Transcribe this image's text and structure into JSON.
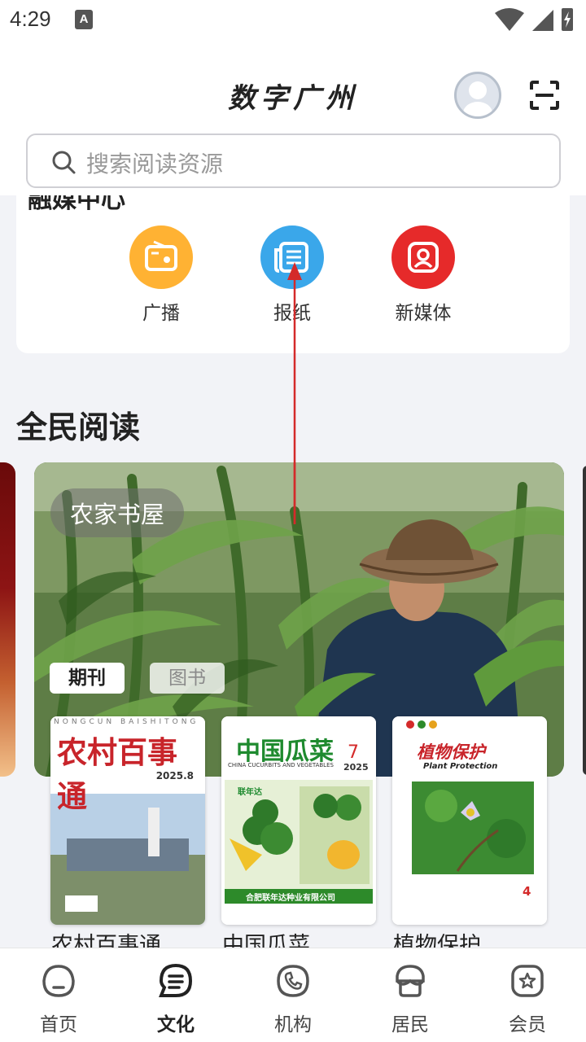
{
  "status": {
    "time": "4:29",
    "notification_letter": "A"
  },
  "header": {
    "title": "数字广州",
    "search_placeholder": "搜索阅读资源"
  },
  "media": {
    "title": "融媒中心",
    "items": [
      {
        "label": "广播",
        "color": "#ffb233"
      },
      {
        "label": "报纸",
        "color": "#3aa7ea"
      },
      {
        "label": "新媒体",
        "color": "#e62a2a"
      }
    ]
  },
  "reading": {
    "section_title": "全民阅读",
    "banner_label": "农家书屋",
    "tabs": [
      "期刊",
      "图书"
    ],
    "books": [
      {
        "title": "农村百事通",
        "cover_title": "农村百事通",
        "cover_subtitle": "NONGCUN BAISHITONG",
        "issue": "2025.8"
      },
      {
        "title": "中国瓜菜",
        "cover_title": "中国瓜菜",
        "cover_subtitle": "CHINA CUCURBITS AND VEGETABLES",
        "issue": "7",
        "year": "2025",
        "brand": "联年达",
        "publisher": "合肥联年达种业有限公司"
      },
      {
        "title": "植物保护",
        "cover_title": "植物保护",
        "cover_subtitle": "Plant Protection",
        "issue": "4"
      }
    ]
  },
  "nav": [
    {
      "label": "首页",
      "icon": "home-icon"
    },
    {
      "label": "文化",
      "icon": "culture-icon"
    },
    {
      "label": "机构",
      "icon": "phone-icon"
    },
    {
      "label": "居民",
      "icon": "resident-icon"
    },
    {
      "label": "会员",
      "icon": "member-icon"
    }
  ],
  "colors": {
    "accent_red": "#d42a2a",
    "nav_active": "#222222"
  }
}
